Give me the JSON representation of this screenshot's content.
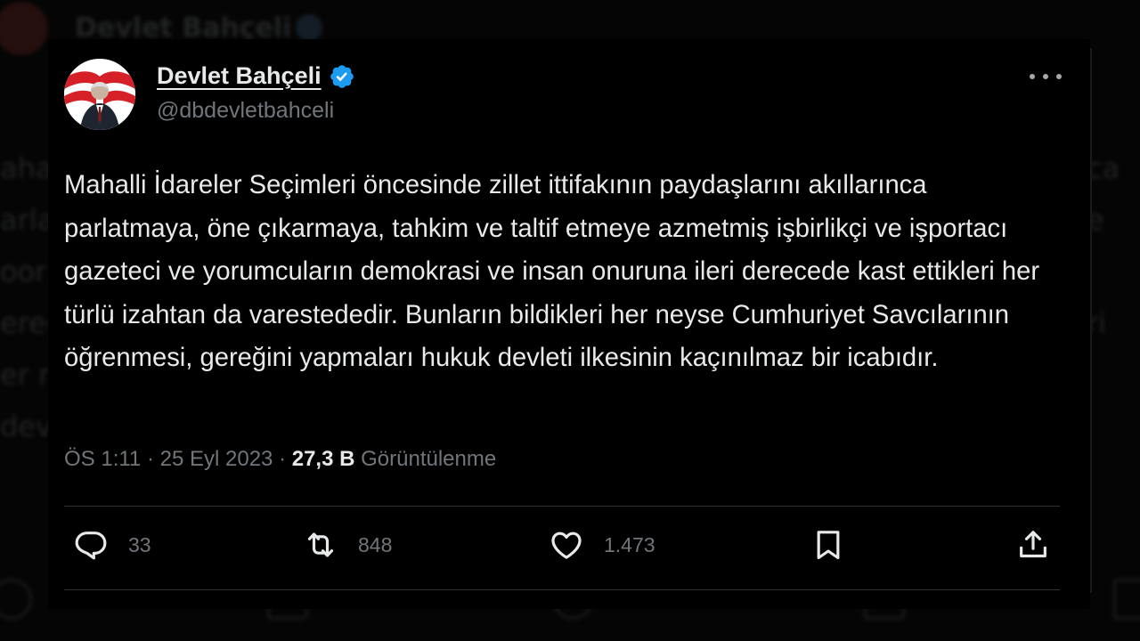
{
  "background": {
    "display_name": "Devlet Bahçeli",
    "left_fragments": [
      "aha",
      "arla",
      "oor",
      "erec",
      "er n",
      "devle"
    ],
    "right_fragments": [
      "ca",
      "e",
      "",
      "ri",
      "",
      ""
    ]
  },
  "tweet": {
    "display_name": "Devlet Bahçeli",
    "handle": "@dbdevletbahceli",
    "verified": true,
    "text": "Mahalli İdareler Seçimleri öncesinde zillet ittifakının paydaşlarını akıllarınca parlatmaya, öne çıkarmaya, tahkim ve taltif etmeye azmetmiş işbirlikçi ve işportacı gazeteci ve yorumcuların demokrasi ve insan onuruna ileri derecede kast ettikleri her türlü izahtan da varestededir. Bunların bildikleri her neyse Cumhuriyet Savcılarının öğrenmesi, gereğini yapmaları hukuk devleti ilkesinin kaçınılmaz bir icabıdır.",
    "time": "ÖS 1:11",
    "date": "25 Eyl 2023",
    "views_count": "27,3 B",
    "views_label": "Görüntülenme"
  },
  "actions": {
    "replies": "33",
    "reposts": "848",
    "likes": "1.473"
  },
  "icons": {
    "verified": "verified-badge-icon",
    "more": "more-dots-icon",
    "reply": "reply-bubble-icon",
    "repost": "repost-arrows-icon",
    "like": "heart-icon",
    "bookmark": "bookmark-icon",
    "share": "share-upload-icon"
  },
  "colors": {
    "background": "#000000",
    "text": "#e7e9ea",
    "muted": "#71767b",
    "verified": "#1d9bf0",
    "divider": "#2f3336"
  }
}
